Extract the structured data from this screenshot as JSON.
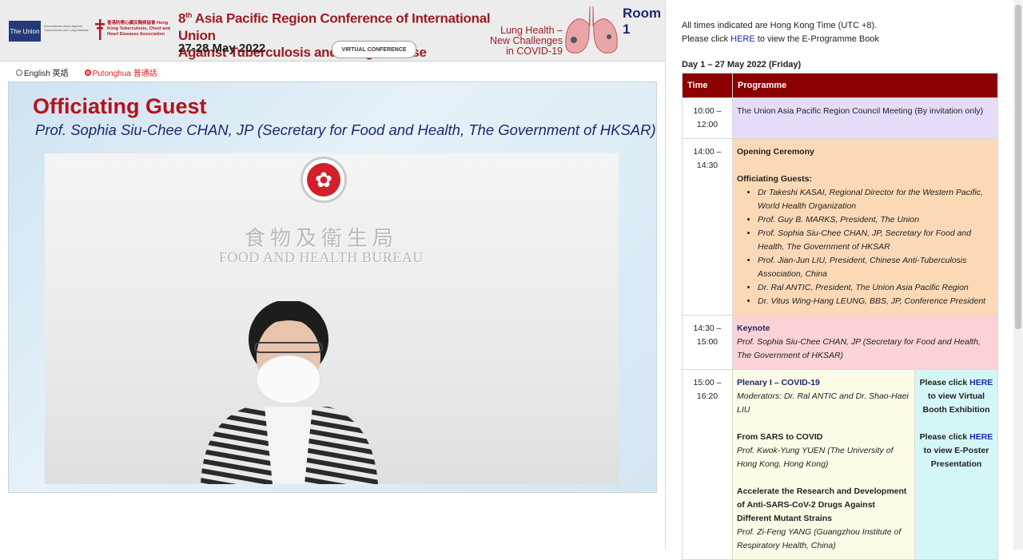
{
  "banner": {
    "union_logo": "The Union",
    "union_small": "International Union Against Tuberculosis and Lung Disease",
    "hk_assoc": "香港防癆心臟及胸病協會 Hong Kong Tuberculosis, Chest and Heart Diseases Association",
    "title_prefix": "8",
    "title_sup": "th",
    "title_line1": " Asia Pacific Region Conference of International Union",
    "title_line2": "Against Tuberculosis and Lung Disease",
    "dates": "27-28 May 2022",
    "virtual": "VIRTUAL CONFERENCE",
    "theme_line1": "Lung Health –",
    "theme_line2": "New Challenges",
    "theme_line3": "in COVID-19",
    "room": "Room 1"
  },
  "lang": {
    "english": "English 英語",
    "putonghua": "Putonghua 普通話",
    "selected": "putonghua"
  },
  "video": {
    "heading": "Officiating Guest",
    "subheading": "Prof. Sophia Siu-Chee CHAN, JP (Secretary for Food and Health, The Government of HKSAR)",
    "wall_cn": "食物及衛生局",
    "wall_en": "FOOD AND HEALTH BUREAU"
  },
  "right": {
    "tz_note": "All times indicated are Hong Kong Time (UTC +8).",
    "click_prefix": "Please click ",
    "here": "HERE",
    "click_suffix": " to view the E-Programme Book",
    "day_title": "Day 1 – 27 May 2022 (Friday)",
    "col_time": "Time",
    "col_programme": "Programme",
    "r1": {
      "time_a": "10:00 –",
      "time_b": "12:00",
      "title": "The Union Asia Pacific Region Council Meeting (By invitation only)"
    },
    "r2": {
      "time_a": "14:00 –",
      "time_b": "14:30",
      "title": "Opening Ceremony",
      "guests_label": "Officiating Guests:",
      "guests": [
        "Dr Takeshi KASAI, Regional Director for the Western Pacific, World Health Organization",
        "Prof. Guy B. MARKS, President, The Union",
        "Prof. Sophia Siu-Chee CHAN, JP, Secretary for Food and Health, The Government of HKSAR",
        "Prof. Jian-Jun LIU, President, Chinese Anti-Tuberculosis Association, China",
        "Dr. Ral ANTIC, President, The Union Asia Pacific Region",
        "Dr. Vitus Wing-Hang LEUNG, BBS, JP, Conference President"
      ]
    },
    "r3": {
      "time_a": "14:30 –",
      "time_b": "15:00",
      "title": "Keynote",
      "desc": "Prof. Sophia Siu-Chee CHAN, JP (Secretary for Food and Health, The Government of HKSAR)"
    },
    "r4": {
      "time_a": "15:00 –",
      "time_b": "16:20",
      "title": "Plenary I – COVID-19",
      "moderators": "Moderators: Dr. Ral ANTIC and Dr. Shao-Haei LIU",
      "talk1_title": "From SARS to COVID",
      "talk1_speaker": "Prof. Kwok-Yung YUEN (The University of Hong Kong, Hong Kong)",
      "talk2_title": "Accelerate the Research and Development of Anti-SARS-CoV-2 Drugs Against Different Mutant Strains",
      "talk2_speaker": "Prof. Zi-Feng YANG (Guangzhou Institute of Respiratory Health, China)",
      "booth_prefix": "Please click ",
      "booth_here": "HERE",
      "booth_suffix": " to view  Virtual Booth Exhibition",
      "poster_prefix": "Please click ",
      "poster_here": "HERE",
      "poster_suffix": " to view E-Poster Presentation"
    }
  }
}
